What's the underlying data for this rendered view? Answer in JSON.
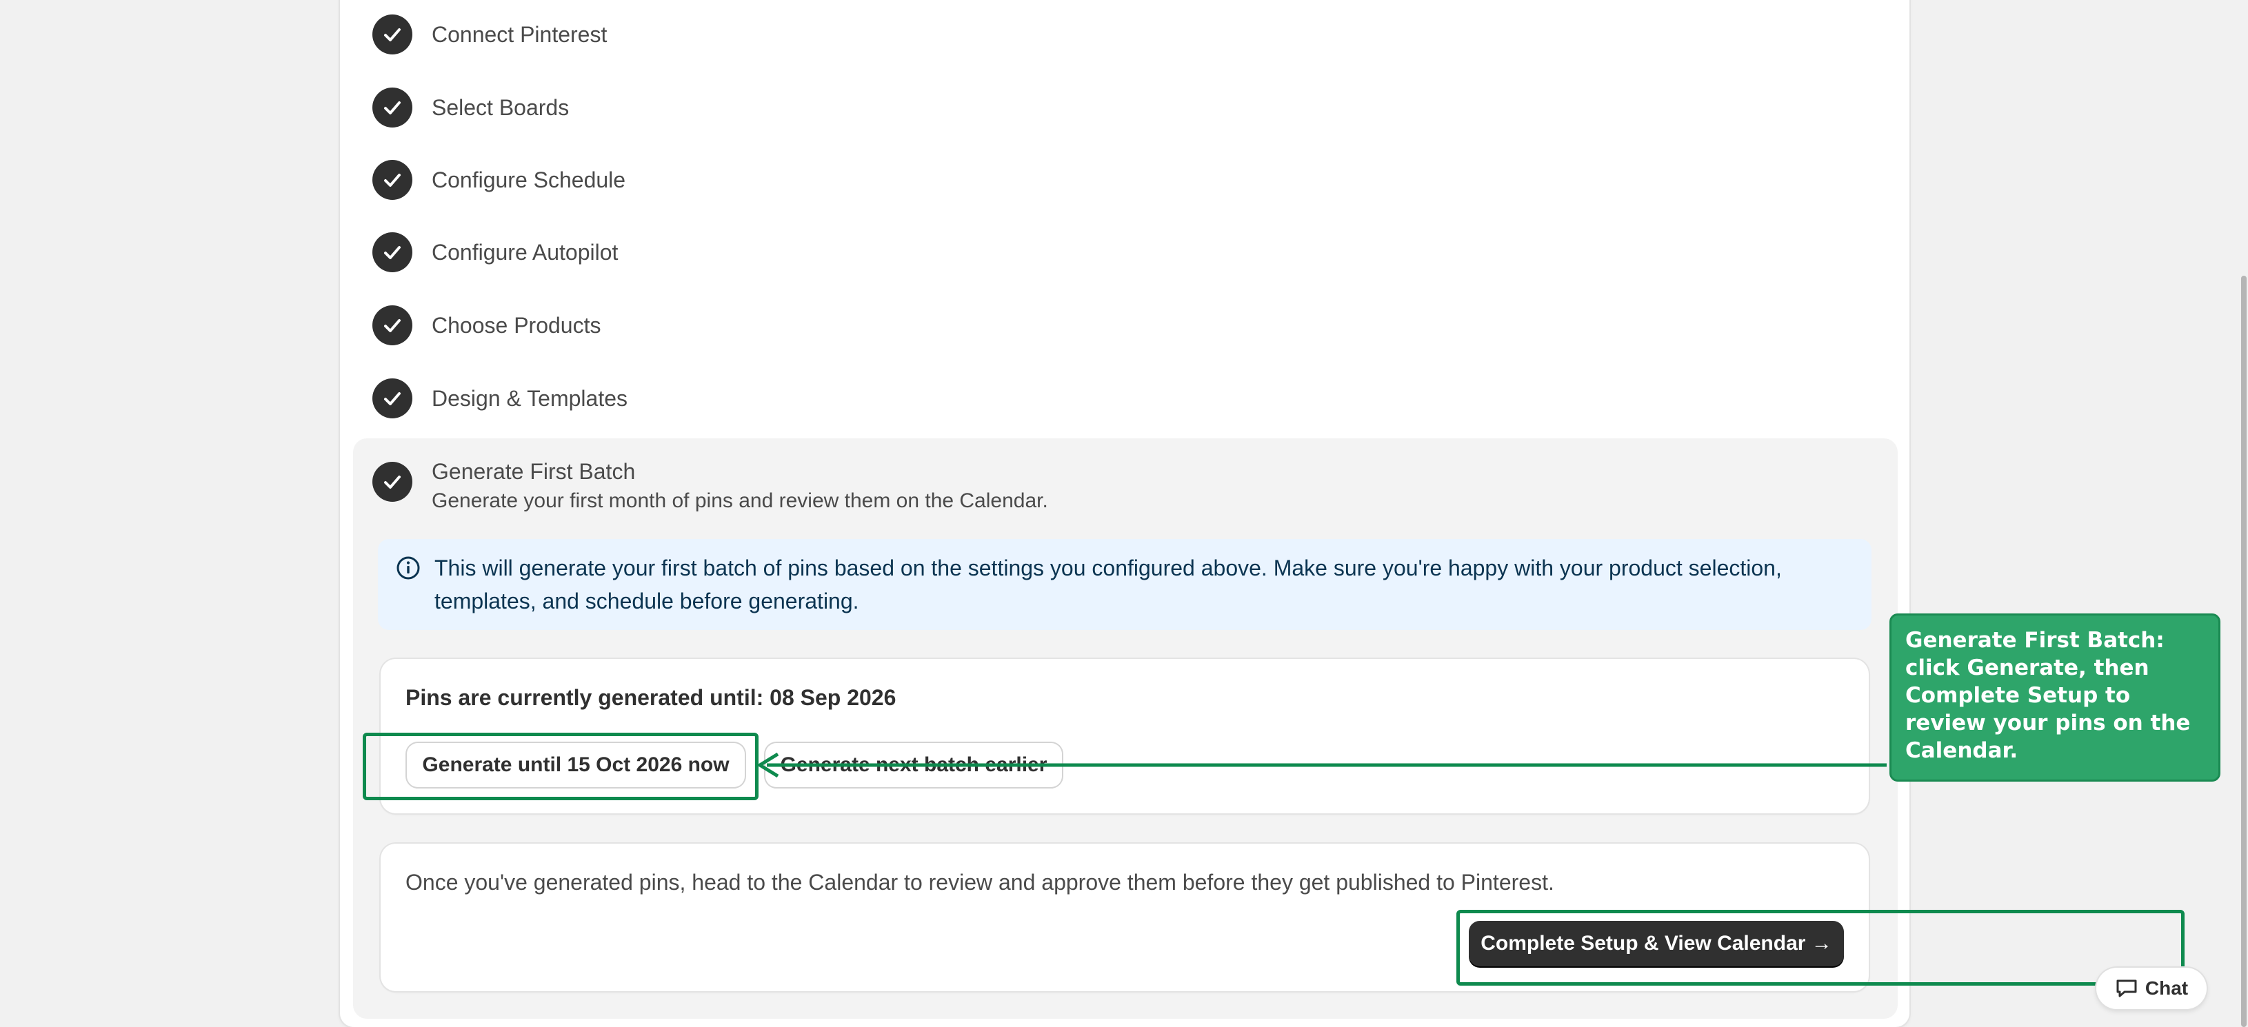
{
  "steps": [
    {
      "label": "Connect Pinterest",
      "done": true
    },
    {
      "label": "Select Boards",
      "done": true
    },
    {
      "label": "Configure Schedule",
      "done": true
    },
    {
      "label": "Configure Autopilot",
      "done": true
    },
    {
      "label": "Choose Products",
      "done": true
    },
    {
      "label": "Design & Templates",
      "done": true
    }
  ],
  "active_step": {
    "title": "Generate First Batch",
    "subtitle": "Generate your first month of pins and review them on the Calendar.",
    "done": true
  },
  "info_banner": {
    "text": "This will generate your first batch of pins based on the settings you configured above. Make sure you're happy with your product selection, templates, and schedule before generating.",
    "icon": "info-icon"
  },
  "generation": {
    "status": "Pins are currently generated until: 08 Sep 2026",
    "generate_now_label": "Generate until 15 Oct 2026 now",
    "generate_next_label": "Generate next batch earlier"
  },
  "completion": {
    "note": "Once you've generated pins, head to the Calendar to review and approve them before they get published to Pinterest.",
    "complete_label": "Complete Setup & View Calendar →"
  },
  "tooltip": {
    "text": "Generate First Batch: click Generate, then Complete Setup to review your pins on the Calendar."
  },
  "chat": {
    "label": "Chat",
    "icon": "chat-bubble-icon"
  },
  "colors": {
    "highlight": "#0e8a4e",
    "tooltip_bg": "#2ea56a",
    "info_bg": "#eaf4ff",
    "dark_button": "#303030"
  }
}
